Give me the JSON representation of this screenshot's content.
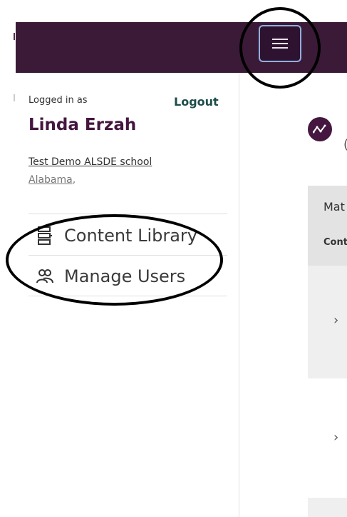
{
  "header": {
    "menu_button": "menu-icon"
  },
  "user": {
    "logged_in_label": "Logged in as",
    "logout_label": "Logout",
    "name": "Linda Erzah",
    "school": "Test Demo ALSDE school",
    "state": "Alabama",
    "state_suffix": ","
  },
  "nav": {
    "items": [
      {
        "label": "Content Library",
        "icon": "content-library-icon"
      },
      {
        "label": "Manage Users",
        "icon": "users-icon"
      }
    ]
  },
  "main": {
    "paren": "(",
    "panel_header_1": "Mat",
    "panel_header_2": "Cont",
    "rows": [
      {
        "chevron": "›"
      },
      {
        "chevron": "›"
      }
    ]
  },
  "colors": {
    "brand": "#3b1a38",
    "logout": "#1d4e4a",
    "name": "#45163f"
  }
}
